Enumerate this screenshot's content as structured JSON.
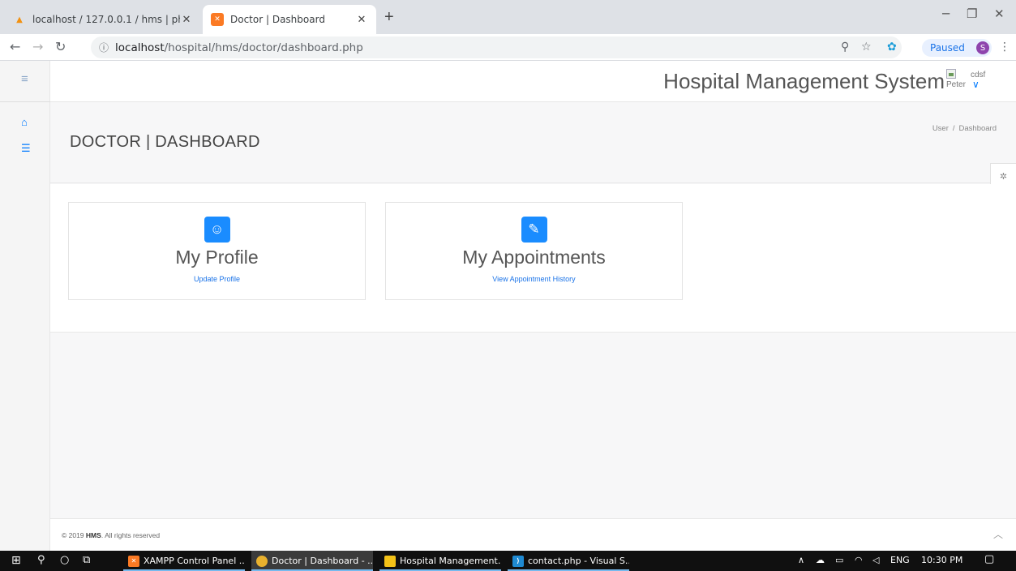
{
  "browser": {
    "tabs": [
      {
        "title": "localhost / 127.0.0.1 / hms | phpM",
        "favicon": "phpmyadmin-icon"
      },
      {
        "title": "Doctor | Dashboard",
        "favicon": "xampp-icon"
      }
    ],
    "new_tab": "+",
    "url_host": "localhost",
    "url_path": "/hospital/hms/doctor/dashboard.php",
    "profile_status": "Paused",
    "profile_initial": "S"
  },
  "header": {
    "app_title": "Hospital Management System",
    "user_image_alt": "Peter",
    "user_name": "cdsf"
  },
  "page": {
    "title": "DOCTOR | DASHBOARD",
    "breadcrumb": [
      "User",
      "Dashboard"
    ]
  },
  "cards": [
    {
      "title": "My Profile",
      "link": "Update Profile",
      "icon": "smile-icon"
    },
    {
      "title": "My Appointments",
      "link": "View Appointment History",
      "icon": "paperclip-icon"
    }
  ],
  "footer": {
    "year": "© 2019",
    "brand": "HMS",
    "rights": ". All rights reserved"
  },
  "taskbar": {
    "items": [
      {
        "label": "XAMPP Control Panel ..."
      },
      {
        "label": "Doctor | Dashboard - ..."
      },
      {
        "label": "Hospital Management..."
      },
      {
        "label": "contact.php - Visual S..."
      }
    ],
    "language": "ENG",
    "time": "10:30 PM"
  },
  "colors": {
    "accent": "#007aff",
    "card_icon_bg": "#1a8cff",
    "link": "#1a73e8"
  }
}
